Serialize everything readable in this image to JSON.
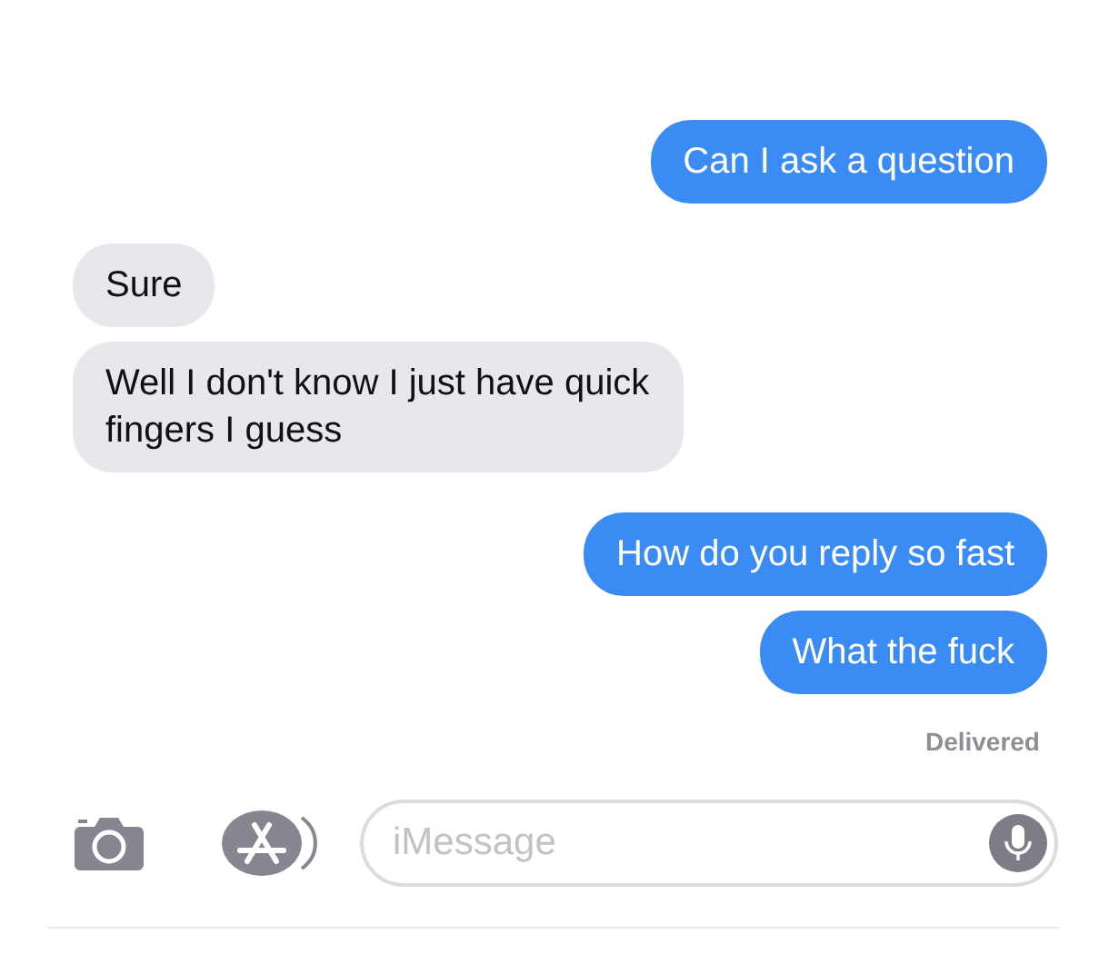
{
  "messages": [
    {
      "kind": "outgoing",
      "text": "Can I ask a question"
    },
    {
      "kind": "incoming",
      "text": "Sure"
    },
    {
      "kind": "incoming",
      "text": "Well I don't know I just have quick fingers I guess"
    },
    {
      "kind": "outgoing",
      "text": "How do you reply so fast"
    },
    {
      "kind": "outgoing",
      "text": "What the fuck"
    }
  ],
  "status": "Delivered",
  "composer": {
    "placeholder": "iMessage"
  }
}
